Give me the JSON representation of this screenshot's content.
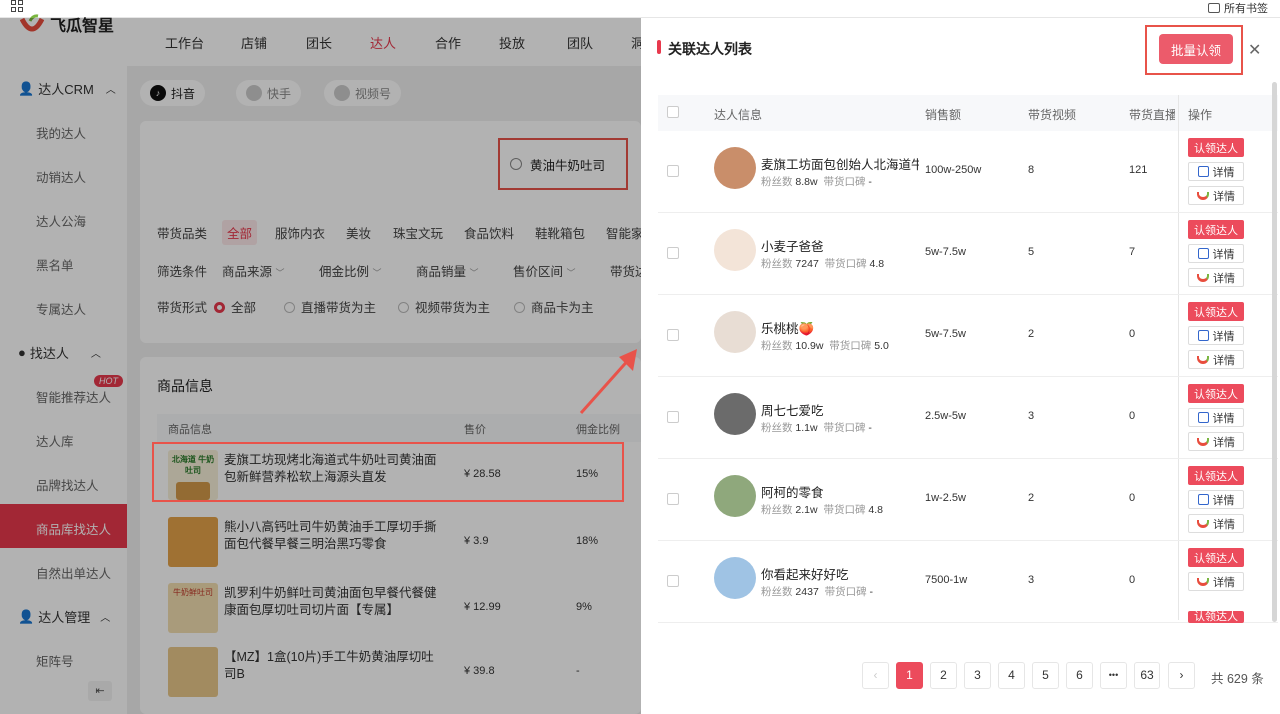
{
  "topstrip": {
    "all_books": "所有书签"
  },
  "header": {
    "app_name": "飞瓜智星",
    "nav": [
      "工作台",
      "店铺",
      "团长",
      "达人",
      "合作",
      "投放",
      "团队",
      "洞"
    ]
  },
  "sidebar": {
    "groups": [
      {
        "label": "达人CRM",
        "items": [
          "我的达人",
          "动销达人",
          "达人公海",
          "黑名单",
          "专属达人"
        ]
      },
      {
        "label": "找达人",
        "items": [
          "智能推荐达人",
          "达人库",
          "品牌找达人",
          "商品库找达人",
          "自然出单达人"
        ]
      },
      {
        "label": "达人管理",
        "items": [
          "矩阵号"
        ]
      }
    ],
    "hot_badge": "HOT",
    "collapse_glyph": "⇤"
  },
  "platforms": [
    "抖音",
    "快手",
    "视频号"
  ],
  "search": {
    "value": "黄油牛奶吐司"
  },
  "filters": {
    "category_label": "带货品类",
    "categories": [
      "全部",
      "服饰内衣",
      "美妆",
      "珠宝文玩",
      "食品饮料",
      "鞋靴箱包",
      "智能家"
    ],
    "condition_label": "筛选条件",
    "conditions": [
      "商品来源",
      "佣金比例",
      "商品销量",
      "售价区间",
      "带货达"
    ],
    "form_label": "带货形式",
    "forms": [
      "全部",
      "直播带货为主",
      "视频带货为主",
      "商品卡为主"
    ]
  },
  "products": {
    "section_title": "商品信息",
    "columns": [
      "商品信息",
      "售价",
      "佣金比例"
    ],
    "rows": [
      {
        "title": "麦旗工坊现烤北海道式牛奶吐司黄油面包新鲜营养松软上海源头直发",
        "price": "¥ 28.58",
        "rate": "15%",
        "thumb_text": "北海道 牛奶吐司"
      },
      {
        "title": "熊小八高钙吐司牛奶黄油手工厚切手撕面包代餐早餐三明治黑巧零食",
        "price": "¥ 3.9",
        "rate": "18%",
        "thumb_text": ""
      },
      {
        "title": "凯罗利牛奶鲜吐司黄油面包早餐代餐健康面包厚切吐司切片面【专属】",
        "price": "¥ 12.99",
        "rate": "9%",
        "thumb_text": "牛奶鲜吐司"
      },
      {
        "title": "【MZ】1盒(10片)手工牛奶黄油厚切吐司B",
        "price": "¥ 39.8",
        "rate": "-",
        "thumb_text": ""
      }
    ]
  },
  "drawer": {
    "title": "关联达人列表",
    "batch_claim": "批量认领",
    "close_glyph": "✕",
    "columns": {
      "info": "达人信息",
      "sales": "销售额",
      "videos": "带货视频",
      "lives": "带货直播",
      "ops": "操作"
    },
    "fans_label": "粉丝数",
    "rep_label": "带货口碑",
    "claim_label": "认领达人",
    "detail_label": "详情",
    "kols": [
      {
        "name": "麦旗工坊面包创始人北海道牛",
        "fans": "8.8w",
        "rep": "-",
        "sales": "100w-250w",
        "videos": "8",
        "lives": "121",
        "two_details": true
      },
      {
        "name": "小麦子爸爸",
        "fans": "7247",
        "rep": "4.8",
        "sales": "5w-7.5w",
        "videos": "5",
        "lives": "7",
        "two_details": true
      },
      {
        "name": "乐桃桃🍑",
        "fans": "10.9w",
        "rep": "5.0",
        "sales": "5w-7.5w",
        "videos": "2",
        "lives": "0",
        "two_details": true
      },
      {
        "name": "周七七爱吃",
        "fans": "1.1w",
        "rep": "-",
        "sales": "2.5w-5w",
        "videos": "3",
        "lives": "0",
        "two_details": true
      },
      {
        "name": "阿柯的零食",
        "fans": "2.1w",
        "rep": "4.8",
        "sales": "1w-2.5w",
        "videos": "2",
        "lives": "0",
        "two_details": true
      },
      {
        "name": "你看起来好好吃",
        "fans": "2437",
        "rep": "-",
        "sales": "7500-1w",
        "videos": "3",
        "lives": "0",
        "two_details": false
      }
    ],
    "pagination": {
      "prev": "‹",
      "pages": [
        "1",
        "2",
        "3",
        "4",
        "5",
        "6",
        "•••",
        "63"
      ],
      "next": "›",
      "current": "1",
      "total": "共 629 条"
    }
  },
  "colors": {
    "accent": "#ec4b5c",
    "highlight": "#e8534a"
  }
}
